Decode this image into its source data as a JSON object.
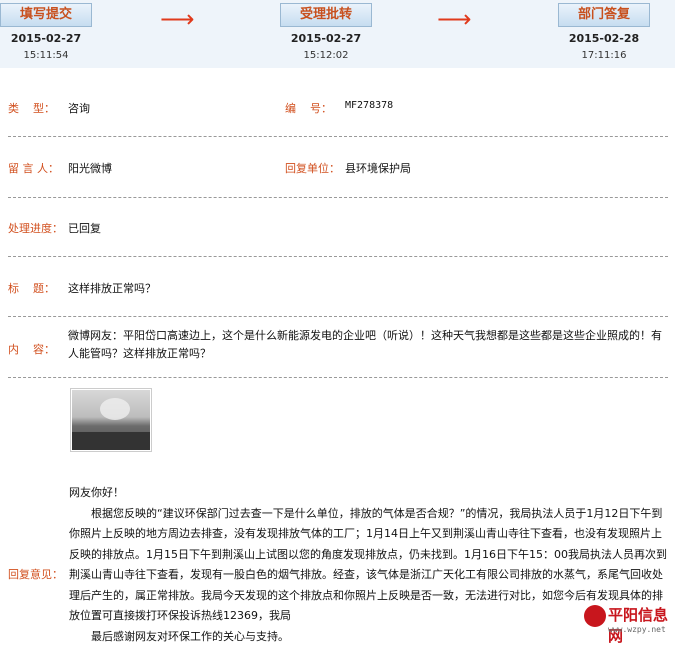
{
  "flow": {
    "steps": [
      {
        "label": "填写提交",
        "date": "2015-02-27",
        "time": "15:11:54"
      },
      {
        "label": "受理批转",
        "date": "2015-02-27",
        "time": "15:12:02"
      },
      {
        "label": "部门答复",
        "date": "2015-02-28",
        "time": "17:11:16"
      }
    ],
    "arrow": "⟶"
  },
  "info": {
    "type_label": "类    型：",
    "type_value": "咨询",
    "number_label": "编    号：",
    "number_value": "MF278378",
    "author_label": "留 言 人：",
    "author_value": "阳光微博",
    "dept_label": "回复单位：",
    "dept_value": "县环境保护局",
    "status_label": "处理进度：",
    "status_value": "已回复",
    "title_label": "标    题：",
    "title_value": "这样排放正常吗？",
    "content_label": "内    容：",
    "content_value": "微博网友：平阳岱口高速边上，这个是什么新能源发电的企业吧（听说）！这种天气我想都是这些都是这些企业照成的！有人能管吗？这样排放正常吗？"
  },
  "reply": {
    "label": "回复意见：",
    "greeting": "网友你好！",
    "para1": "根据您反映的“建议环保部门过去查一下是什么单位，排放的气体是否合规？”的情况，我局执法人员于1月12日下午到你照片上反映的地方周边去排查，没有发现排放气体的工厂；1月14日上午又到荆溪山青山寺往下查看，也没有发现照片上反映的排放点。1月15日下午到荆溪山上试图以您的角度发现排放点，仍未找到。1月16日下午15：00我局执法人员再次到荆溪山青山寺往下查看，发现有一股白色的烟气排放。经查，该气体是浙江广天化工有限公司排放的水蒸气，系尾气回收处理后产生的，属正常排放。我局今天发现的这个排放点和你照片上反映是否一致，无法进行对比，如您今后有发现具体的排放位置可直接拨打环保投诉热线12369，我局",
    "para2": "最后感谢网友对环保工作的关心与支持。"
  },
  "watermark": {
    "name": "平阳信息网",
    "url": "www.wzpy.net"
  },
  "colors": {
    "label": "#d2501f",
    "step_text": "#c8501e",
    "arrow": "#e03a1c",
    "header_bg": "#eef4fa"
  }
}
